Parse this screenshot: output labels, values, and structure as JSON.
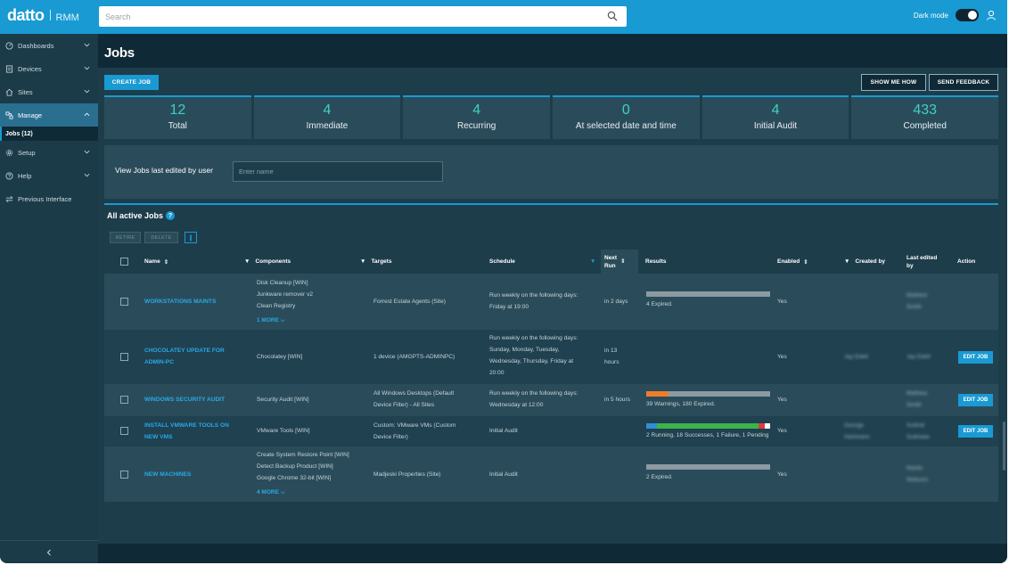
{
  "brand": {
    "name": "datto",
    "product": "RMM"
  },
  "search": {
    "placeholder": "Search"
  },
  "topbar": {
    "dark_mode_label": "Dark mode"
  },
  "sidebar": {
    "items": [
      {
        "label": "Dashboards",
        "icon": "gauge-icon"
      },
      {
        "label": "Devices",
        "icon": "devices-icon"
      },
      {
        "label": "Sites",
        "icon": "home-icon"
      },
      {
        "label": "Manage",
        "icon": "manage-icon",
        "active": true
      },
      {
        "label": "Setup",
        "icon": "gear-icon"
      },
      {
        "label": "Help",
        "icon": "help-icon"
      },
      {
        "label": "Previous Interface",
        "icon": "swap-icon"
      }
    ],
    "sub_item": "Jobs (12)",
    "collapse_icon": "chevron-left-icon"
  },
  "page": {
    "title": "Jobs",
    "create_job": "CREATE JOB",
    "show_me_how": "SHOW ME HOW",
    "send_feedback": "SEND FEEDBACK"
  },
  "stats": [
    {
      "value": "12",
      "label": "Total"
    },
    {
      "value": "4",
      "label": "Immediate"
    },
    {
      "value": "4",
      "label": "Recurring"
    },
    {
      "value": "0",
      "label": "At selected date and time"
    },
    {
      "value": "4",
      "label": "Initial Audit"
    },
    {
      "value": "433",
      "label": "Completed"
    }
  ],
  "filter": {
    "label": "View Jobs last edited by user",
    "placeholder": "Enter name"
  },
  "jobs": {
    "heading": "All active Jobs",
    "help": "?",
    "retire": "RETIRE",
    "delete": "DELETE",
    "columns": {
      "name": "Name",
      "components": "Components",
      "targets": "Targets",
      "schedule": "Schedule",
      "next_run_1": "Next",
      "next_run_2": "Run",
      "results": "Results",
      "enabled": "Enabled",
      "created_by": "Created by",
      "last_edited_1": "Last edited",
      "last_edited_2": "by",
      "action": "Action"
    },
    "rows": [
      {
        "name_lines": [
          "WORKSTATIONS MAINTS"
        ],
        "components": [
          "Disk Cleanup [WIN]",
          "Junkware remover v2",
          "Clean Registry"
        ],
        "more": "1 MORE",
        "targets": [
          "Forrest Estate Agents (Site)"
        ],
        "schedule": [
          "Run weekly on the following days:",
          "Friday at 19:00"
        ],
        "next_run": [
          "in 2 days"
        ],
        "results_text": "4 Expired.",
        "enabled": "Yes",
        "created_by": [],
        "last_edited": [
          "Mathew",
          "Smith"
        ],
        "edit": ""
      },
      {
        "name_lines": [
          "CHOCOLATEY UPDATE FOR",
          "ADMIN-PC"
        ],
        "components": [
          "Chocolatey [WIN]"
        ],
        "more": "",
        "targets": [
          "1 device (AMGPTS-ADMINPC)"
        ],
        "schedule": [
          "Run weekly on the following days:",
          "Sunday, Monday, Tuesday,",
          "Wednesday, Thursday, Friday at",
          "20:00"
        ],
        "next_run": [
          "in 13",
          "hours"
        ],
        "results_text": "",
        "enabled": "Yes",
        "created_by": [
          "Jay Edell"
        ],
        "last_edited": [
          "Jay Edell"
        ],
        "edit": "EDIT JOB"
      },
      {
        "name_lines": [
          "WINDOWS SECURITY AUDIT"
        ],
        "components": [
          "Security Audit [WIN]"
        ],
        "more": "",
        "targets": [
          "All Windows Desktops (Default",
          "Device Filter) - All Sites"
        ],
        "schedule": [
          "Run weekly on the following days:",
          "Wednesday at 12:00"
        ],
        "next_run": [
          "in 5 hours"
        ],
        "results_text": "39 Warnings, 180 Expired.",
        "enabled": "Yes",
        "created_by": [],
        "last_edited": [
          "Mathew",
          "Smith"
        ],
        "edit": "EDIT JOB"
      },
      {
        "name_lines": [
          "INSTALL VMWARE TOOLS ON",
          "NEW VMS"
        ],
        "components": [
          "VMware Tools [WIN]"
        ],
        "more": "",
        "targets": [
          "Custom: VMware VMs (Custom",
          "Device Filter)"
        ],
        "schedule": [
          "Initial Audit"
        ],
        "next_run": [],
        "results_text": "2 Running, 18 Successes, 1 Failure, 1 Pending",
        "enabled": "Yes",
        "created_by": [
          "George",
          "Hartmann"
        ],
        "last_edited": [
          "Sukhdi",
          "Sukhaee"
        ],
        "edit": "EDIT JOB"
      },
      {
        "name_lines": [
          "NEW MACHINES"
        ],
        "components": [
          "Create System Restore Point [WIN]",
          "Detect Backup Product [WIN]",
          "Google Chrome 32-bit [WIN]"
        ],
        "more": "4 MORE",
        "targets": [
          "Madjeski Properties (Site)"
        ],
        "schedule": [
          "Initial Audit"
        ],
        "next_run": [],
        "results_text": "2 Expired.",
        "enabled": "Yes",
        "created_by": [],
        "last_edited": [
          "Martin",
          "Wokunn"
        ],
        "edit": ""
      }
    ]
  },
  "colors": {
    "accent": "#199ad3",
    "stat_number": "#3ed1c4",
    "warning": "#f07c2a",
    "expired": "#8c9aa1",
    "running": "#2f8fd8",
    "success": "#3bb54a",
    "failure": "#e03b3b",
    "pending": "#ffffff"
  }
}
